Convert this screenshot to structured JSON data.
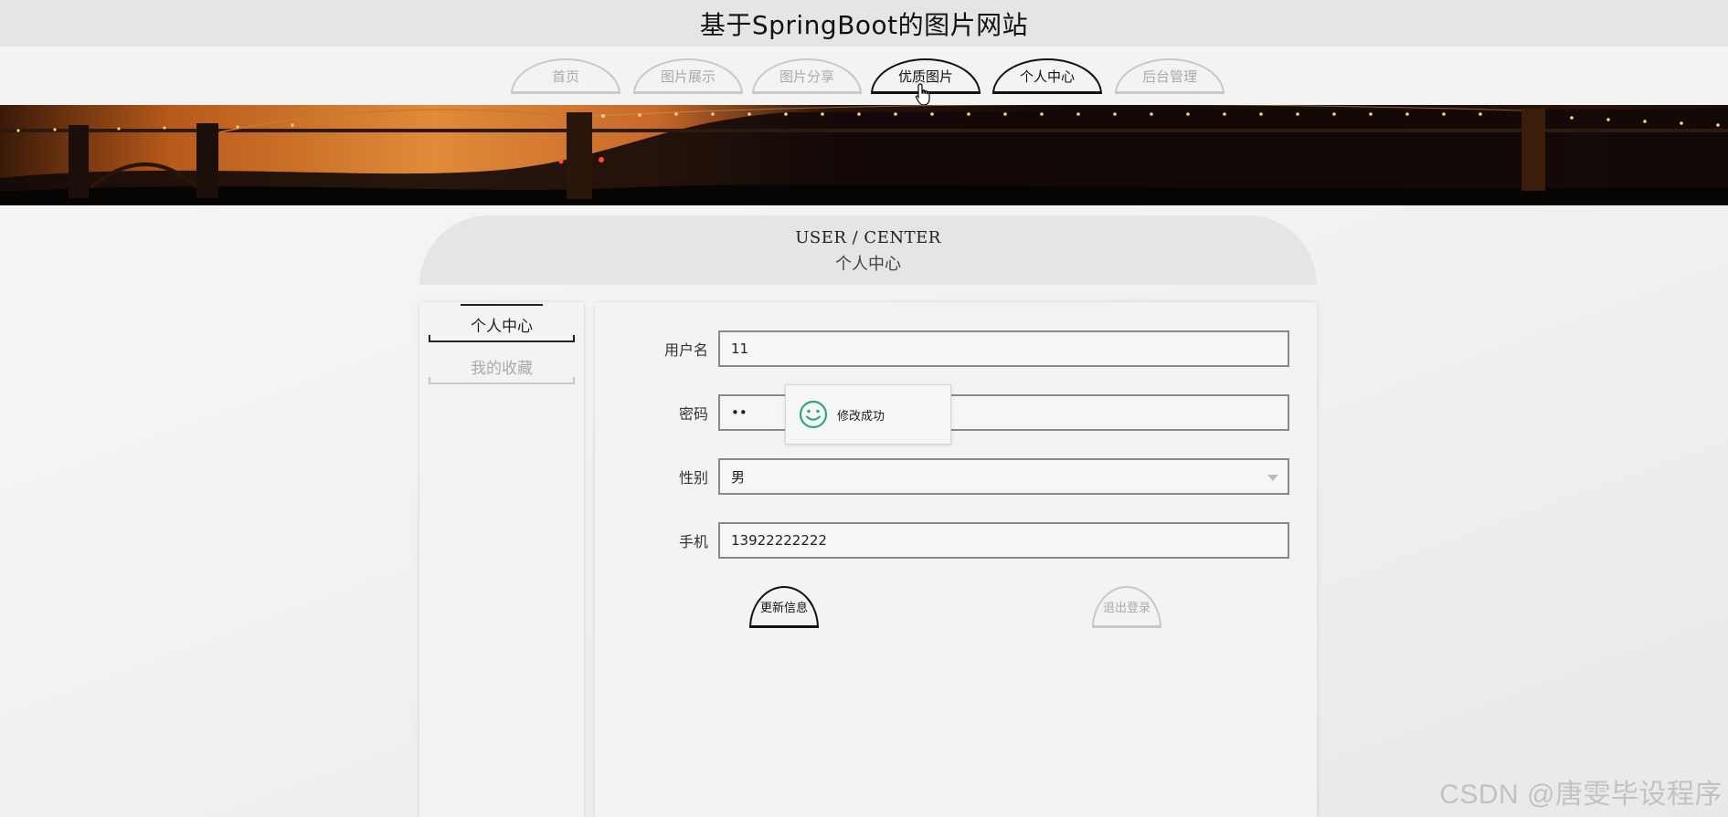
{
  "site": {
    "title": "基于SpringBoot的图片网站"
  },
  "nav": {
    "items": [
      {
        "label": "首页",
        "active": false
      },
      {
        "label": "图片展示",
        "active": false
      },
      {
        "label": "图片分享",
        "active": false
      },
      {
        "label": "优质图片",
        "active": true
      },
      {
        "label": "个人中心",
        "active": true
      },
      {
        "label": "后台管理",
        "active": false
      }
    ]
  },
  "user_center": {
    "title_en": "USER / CENTER",
    "title_cn": "个人中心"
  },
  "sidebar": {
    "items": [
      {
        "label": "个人中心",
        "active": true
      },
      {
        "label": "我的收藏",
        "active": false
      }
    ]
  },
  "form": {
    "username": {
      "label": "用户名",
      "value": "11"
    },
    "password": {
      "label": "密码",
      "value": "••"
    },
    "gender": {
      "label": "性别",
      "value": "男"
    },
    "phone": {
      "label": "手机",
      "value": "13922222222"
    },
    "update_button": "更新信息",
    "logout_button": "退出登录"
  },
  "toast": {
    "message": "修改成功",
    "icon": "smile-icon",
    "icon_color": "#2eaa7a"
  },
  "watermark": "CSDN @唐雯毕设程序",
  "colors": {
    "active_border": "#111111",
    "inactive_border": "#c8c8c8",
    "header_bg": "#e4e5e7"
  }
}
